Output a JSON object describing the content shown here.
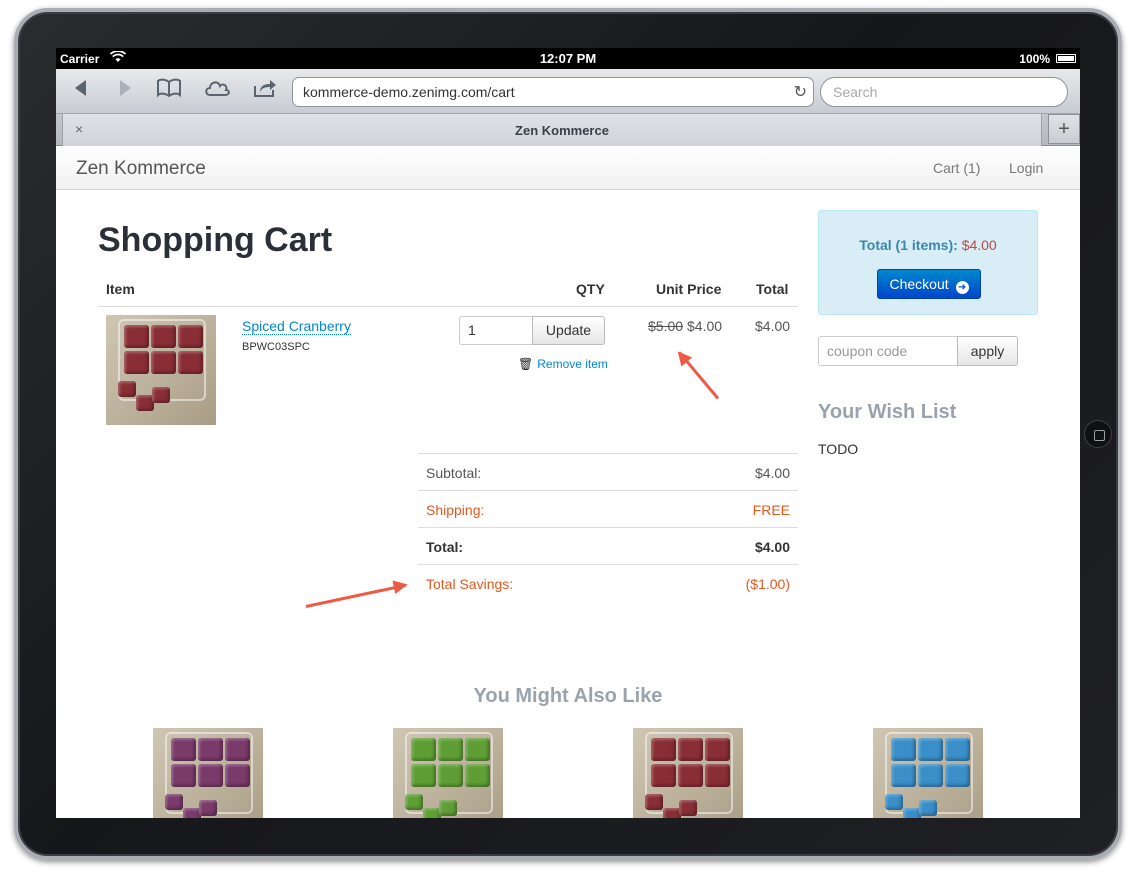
{
  "statusbar": {
    "carrier": "Carrier",
    "time": "12:07 PM",
    "battery": "100%"
  },
  "browser": {
    "url": "kommerce-demo.zenimg.com/cart",
    "search_placeholder": "Search",
    "tab_title": "Zen Kommerce",
    "tab_close": "×",
    "new_tab": "+"
  },
  "navbar": {
    "brand": "Zen Kommerce",
    "cart": "Cart (1)",
    "login": "Login"
  },
  "cart": {
    "title": "Shopping Cart",
    "columns": {
      "item": "Item",
      "qty": "QTY",
      "unit_price": "Unit Price",
      "total": "Total"
    },
    "items": [
      {
        "name": "Spiced Cranberry",
        "sku": "BPWC03SPC",
        "qty": "1",
        "update_label": "Update",
        "remove_label": "Remove item",
        "price_original": "$5.00",
        "price_sale": "$4.00",
        "line_total": "$4.00",
        "color": "#8a2e36"
      }
    ],
    "summary": {
      "subtotal_label": "Subtotal:",
      "subtotal": "$4.00",
      "shipping_label": "Shipping:",
      "shipping": "FREE",
      "total_label": "Total:",
      "total": "$4.00",
      "savings_label": "Total Savings:",
      "savings": "($1.00)"
    }
  },
  "sidebar": {
    "total_label": "Total (1 items):",
    "total_amount": "$4.00",
    "checkout_label": "Checkout",
    "coupon_placeholder": "coupon code",
    "apply_label": "apply",
    "wishlist_title": "Your Wish List",
    "wishlist_body": "TODO"
  },
  "recommendations": {
    "title": "You Might Also Like",
    "products": [
      {
        "color": "#7a3a6a"
      },
      {
        "color": "#5f9e35"
      },
      {
        "color": "#8a2e36"
      },
      {
        "color": "#3a8fc9"
      }
    ]
  },
  "colors": {
    "link": "#0088cc",
    "savings": "#e2591f",
    "annotation_arrow": "#ee5a45"
  }
}
